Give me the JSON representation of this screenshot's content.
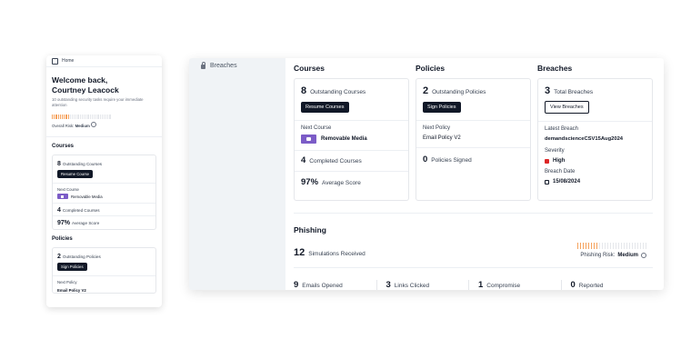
{
  "mobile": {
    "nav": {
      "home_label": "Home"
    },
    "welcome": {
      "title": "Welcome back, Courtney Leacock",
      "subtitle": "10 outstanding security tasks require your immediate attention",
      "risk_prefix": "Overall Risk:",
      "risk_value": "Medium",
      "risk_level": 0.3
    },
    "courses": {
      "section_title": "Courses",
      "outstanding_count": "8",
      "outstanding_label": "Outstanding Courses",
      "resume_button": "Resume Course",
      "next_label": "Next Course",
      "next_course": "Removable Media",
      "completed_count": "4",
      "completed_label": "Completed Courses",
      "score_value": "97%",
      "score_label": "Average Score"
    },
    "policies": {
      "section_title": "Policies",
      "outstanding_count": "2",
      "outstanding_label": "Outstanding Policies",
      "sign_button": "Sign Policies",
      "next_label": "Next Policy",
      "next_policy": "Email Policy V2"
    }
  },
  "desktop": {
    "sidebar": {
      "items": [
        {
          "label": "Breaches",
          "icon": "lock-icon"
        }
      ]
    },
    "courses": {
      "title": "Courses",
      "outstanding_count": "8",
      "outstanding_label": "Outstanding Courses",
      "resume_button": "Resume Courses",
      "next_label": "Next Course",
      "next_course": "Removable Media",
      "completed_count": "4",
      "completed_label": "Completed Courses",
      "score_value": "97%",
      "score_label": "Average Score"
    },
    "policies": {
      "title": "Policies",
      "outstanding_count": "2",
      "outstanding_label": "Outstanding Policies",
      "sign_button": "Sign Policies",
      "next_label": "Next Policy",
      "next_policy": "Email Policy V2",
      "signed_count": "0",
      "signed_label": "Policies Signed"
    },
    "breaches": {
      "title": "Breaches",
      "total_count": "3",
      "total_label": "Total Breaches",
      "view_button": "View Breaches",
      "latest_label": "Latest Breach",
      "latest_value": "demandscienceCSV15Aug2024",
      "severity_label": "Severity",
      "severity_value": "High",
      "date_label": "Breach Date",
      "date_value": "15/08/2024"
    },
    "phishing": {
      "title": "Phishing",
      "simulations_count": "12",
      "simulations_label": "Simulations Received",
      "risk_prefix": "Phishing Risk:",
      "risk_value": "Medium",
      "risk_level": 0.3,
      "stats": [
        {
          "value": "9",
          "label": "Emails Opened"
        },
        {
          "value": "3",
          "label": "Links Clicked"
        },
        {
          "value": "1",
          "label": "Compromise"
        },
        {
          "value": "0",
          "label": "Reported"
        }
      ]
    }
  },
  "colors": {
    "accent_purple": "#7c5cc7",
    "risk_orange": "#f5a25d",
    "severity_red": "#dc2626",
    "button_dark": "#111827"
  }
}
